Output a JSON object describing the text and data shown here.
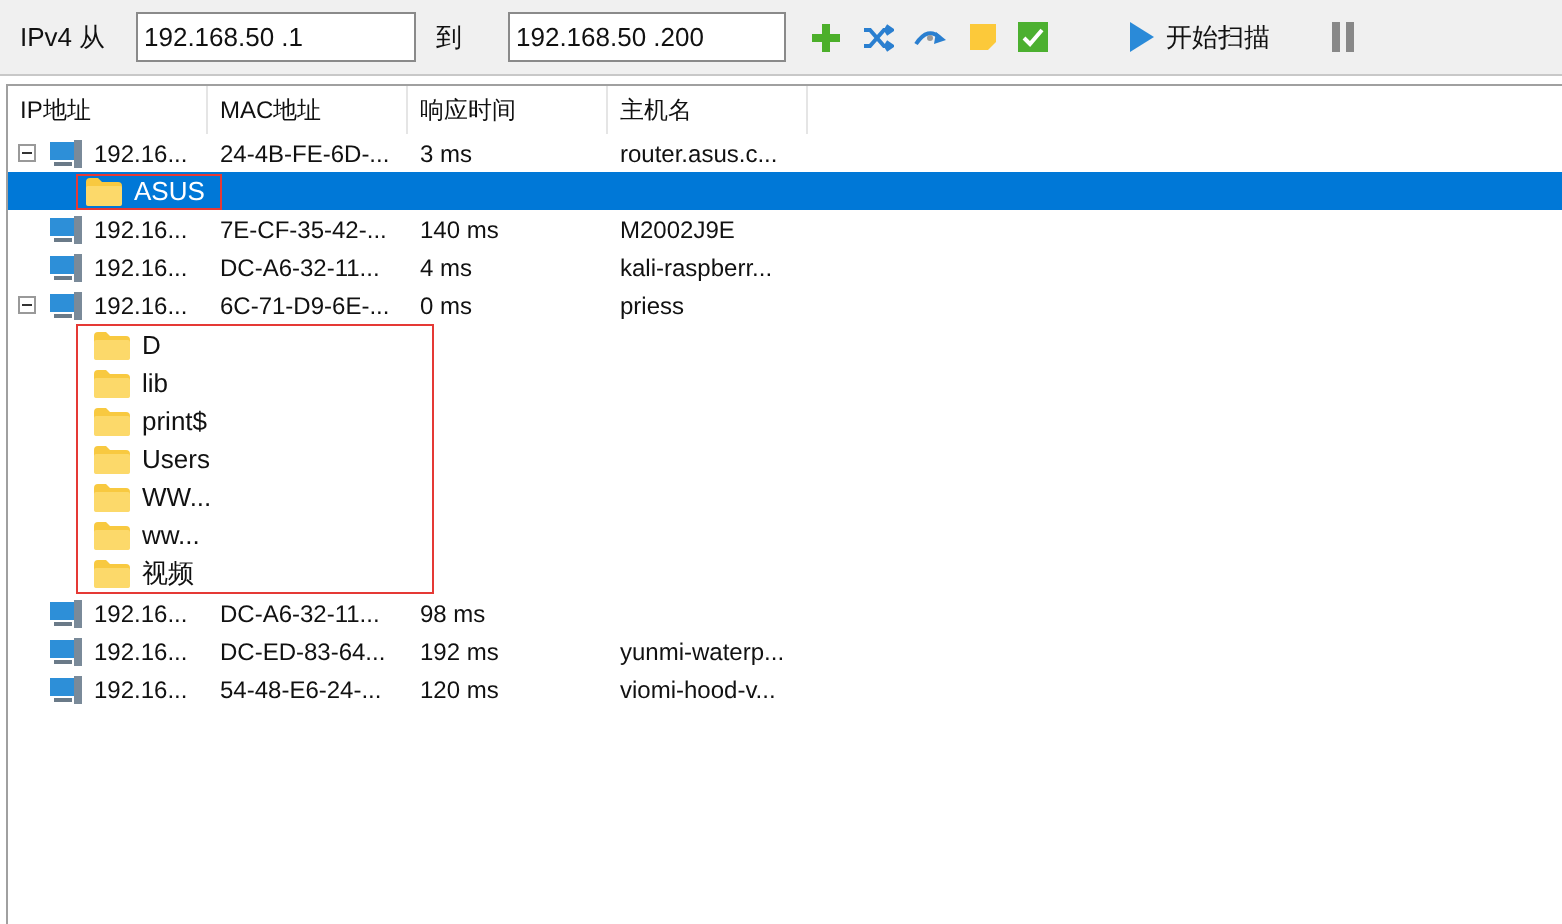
{
  "toolbar": {
    "from_label": "IPv4 从",
    "from_value": "192.168.50 .1",
    "to_label": "到",
    "to_value": "192.168.50 .200",
    "scan_button": "开始扫描"
  },
  "columns": [
    "IP地址",
    "MAC地址",
    "响应时间",
    "主机名"
  ],
  "hosts": [
    {
      "ip": "192.16...",
      "mac": "24-4B-FE-6D-...",
      "time": "3 ms",
      "hostname": "router.asus.c...",
      "expanded": true,
      "children": [
        {
          "label": "ASUS",
          "selected": true,
          "annotated": true
        }
      ]
    },
    {
      "ip": "192.16...",
      "mac": "7E-CF-35-42-...",
      "time": "140 ms",
      "hostname": "M2002J9E"
    },
    {
      "ip": "192.16...",
      "mac": "DC-A6-32-11...",
      "time": "4 ms",
      "hostname": "kali-raspberr..."
    },
    {
      "ip": "192.16...",
      "mac": "6C-71-D9-6E-...",
      "time": "0 ms",
      "hostname": "priess",
      "expanded": true,
      "annotated": true,
      "children": [
        {
          "label": "D",
          "selected": false,
          "annotated": false
        },
        {
          "label": "lib",
          "selected": false,
          "annotated": false
        },
        {
          "label": "print$",
          "selected": false,
          "annotated": false
        },
        {
          "label": "Users",
          "selected": false,
          "annotated": false
        },
        {
          "label": "WW...",
          "selected": false,
          "annotated": false
        },
        {
          "label": "ww...",
          "selected": false,
          "annotated": false
        },
        {
          "label": "视频",
          "selected": false,
          "annotated": false
        }
      ]
    },
    {
      "ip": "192.16...",
      "mac": "DC-A6-32-11...",
      "time": "98 ms"
    },
    {
      "ip": "192.16...",
      "mac": "DC-ED-83-64...",
      "time": "192 ms",
      "hostname": "yunmi-waterp..."
    },
    {
      "ip": "192.16...",
      "mac": "54-48-E6-24-...",
      "time": "120 ms",
      "hostname": "viomi-hood-v..."
    }
  ]
}
